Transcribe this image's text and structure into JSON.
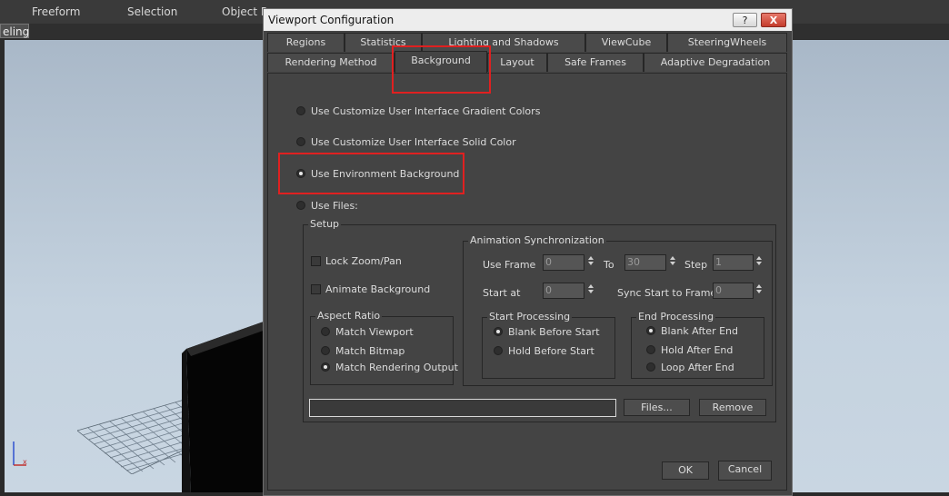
{
  "menubar": {
    "items": [
      "Freeform",
      "Selection",
      "Object P"
    ],
    "mode_label": "eling"
  },
  "dialog": {
    "title": "Viewport Configuration",
    "help_label": "?",
    "close_label": "X",
    "tabs_row1": [
      "Regions",
      "Statistics",
      "Lighting and Shadows",
      "ViewCube",
      "SteeringWheels"
    ],
    "tabs_row2": [
      "Rendering Method",
      "Background",
      "Layout",
      "Safe Frames",
      "Adaptive Degradation"
    ],
    "active_tab": "Background",
    "options": {
      "gradient": "Use Customize User Interface Gradient Colors",
      "solid": "Use Customize User Interface Solid Color",
      "environment": "Use Environment Background",
      "files": "Use Files:"
    },
    "selected_option": "environment",
    "setup": {
      "legend": "Setup",
      "lock_zoom_pan": "Lock Zoom/Pan",
      "animate_background": "Animate Background",
      "aspect_ratio": {
        "legend": "Aspect Ratio",
        "match_viewport": "Match Viewport",
        "match_bitmap": "Match Bitmap",
        "match_rendering_output": "Match Rendering Output"
      },
      "animation_sync": {
        "legend": "Animation Synchronization",
        "use_frame_label": "Use Frame",
        "use_frame_value": "0",
        "to_label": "To",
        "to_value": "30",
        "step_label": "Step",
        "step_value": "1",
        "start_at_label": "Start at",
        "start_at_value": "0",
        "sync_start_label": "Sync Start to Frame",
        "sync_start_value": "0",
        "start_processing": {
          "legend": "Start Processing",
          "blank_before": "Blank Before Start",
          "hold_before": "Hold Before Start"
        },
        "end_processing": {
          "legend": "End Processing",
          "blank_after": "Blank After End",
          "hold_after": "Hold After End",
          "loop_after": "Loop After End"
        }
      },
      "file_path": "",
      "files_button": "Files...",
      "remove_button": "Remove"
    },
    "ok_button": "OK",
    "cancel_button": "Cancel"
  },
  "colors": {
    "highlight": "#e02020",
    "panel": "#444444",
    "viewport_sky": "#c4d2df"
  }
}
